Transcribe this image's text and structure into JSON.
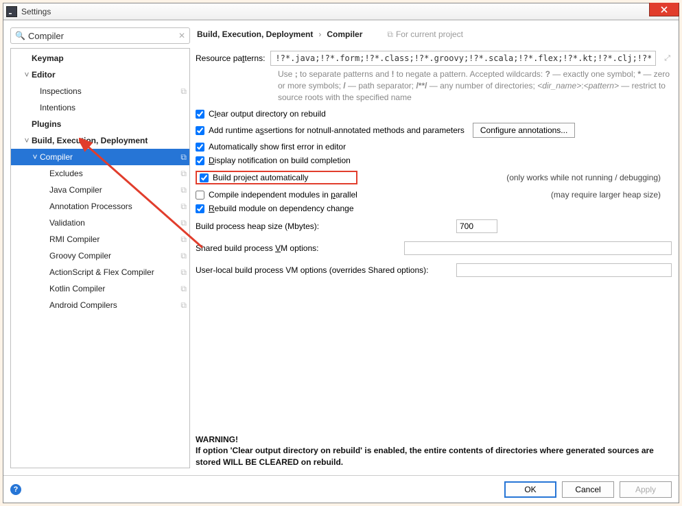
{
  "window": {
    "title": "Settings"
  },
  "search": {
    "value": "Compiler"
  },
  "tree": [
    {
      "label": "Keymap",
      "depth": 0,
      "bold": true,
      "arrow": "",
      "copy": false,
      "selected": false
    },
    {
      "label": "Editor",
      "depth": 0,
      "bold": true,
      "arrow": "˅",
      "copy": false,
      "selected": false
    },
    {
      "label": "Inspections",
      "depth": 1,
      "bold": false,
      "arrow": "",
      "copy": true,
      "selected": false
    },
    {
      "label": "Intentions",
      "depth": 1,
      "bold": false,
      "arrow": "",
      "copy": false,
      "selected": false
    },
    {
      "label": "Plugins",
      "depth": 0,
      "bold": true,
      "arrow": "",
      "copy": false,
      "selected": false
    },
    {
      "label": "Build, Execution, Deployment",
      "depth": 0,
      "bold": true,
      "arrow": "˅",
      "copy": false,
      "selected": false
    },
    {
      "label": "Compiler",
      "depth": 1,
      "bold": false,
      "arrow": "˅",
      "copy": true,
      "selected": true
    },
    {
      "label": "Excludes",
      "depth": 2,
      "bold": false,
      "arrow": "",
      "copy": true,
      "selected": false
    },
    {
      "label": "Java Compiler",
      "depth": 2,
      "bold": false,
      "arrow": "",
      "copy": true,
      "selected": false
    },
    {
      "label": "Annotation Processors",
      "depth": 2,
      "bold": false,
      "arrow": "",
      "copy": true,
      "selected": false
    },
    {
      "label": "Validation",
      "depth": 2,
      "bold": false,
      "arrow": "",
      "copy": true,
      "selected": false
    },
    {
      "label": "RMI Compiler",
      "depth": 2,
      "bold": false,
      "arrow": "",
      "copy": true,
      "selected": false
    },
    {
      "label": "Groovy Compiler",
      "depth": 2,
      "bold": false,
      "arrow": "",
      "copy": true,
      "selected": false
    },
    {
      "label": "ActionScript & Flex Compiler",
      "depth": 2,
      "bold": false,
      "arrow": "",
      "copy": true,
      "selected": false
    },
    {
      "label": "Kotlin Compiler",
      "depth": 2,
      "bold": false,
      "arrow": "",
      "copy": true,
      "selected": false
    },
    {
      "label": "Android Compilers",
      "depth": 2,
      "bold": false,
      "arrow": "",
      "copy": true,
      "selected": false
    }
  ],
  "breadcrumb": {
    "a": "Build, Execution, Deployment",
    "b": "Compiler",
    "proj": "For current project"
  },
  "form": {
    "resource_label": "Resource patterns:",
    "resource_value": "!?*.java;!?*.form;!?*.class;!?*.groovy;!?*.scala;!?*.flex;!?*.kt;!?*.clj;!?*.aj",
    "hint_html": "Use <b>;</b> to separate patterns and <b>!</b> to negate a pattern. Accepted wildcards: <b>?</b> — exactly one symbol; <b>*</b> — zero or more symbols; <b>/</b> — path separator; <b>/**/</b> — any number of directories; <i>&lt;dir_name&gt;</i>:<i>&lt;pattern&gt;</i> — restrict to source roots with the specified name",
    "chk_clear": "Clear output directory on rebuild",
    "chk_assert": "Add runtime assertions for notnull-annotated methods and parameters",
    "btn_conf": "Configure annotations...",
    "chk_autoerr": "Automatically show first error in editor",
    "chk_notify": "Display notification on build completion",
    "chk_auto": "Build project automatically",
    "note_auto": "(only works while not running / debugging)",
    "chk_parallel": "Compile independent modules in parallel",
    "note_parallel": "(may require larger heap size)",
    "chk_rebuild": "Rebuild module on dependency change",
    "heap_label": "Build process heap size (Mbytes):",
    "heap_value": "700",
    "shared_label": "Shared build process VM options:",
    "shared_value": "",
    "user_label": "User-local build process VM options (overrides Shared options):",
    "user_value": ""
  },
  "warning": {
    "title": "WARNING!",
    "body": "If option 'Clear output directory on rebuild' is enabled, the entire contents of directories where generated sources are stored WILL BE CLEARED on rebuild."
  },
  "footer": {
    "ok": "OK",
    "cancel": "Cancel",
    "apply": "Apply"
  }
}
